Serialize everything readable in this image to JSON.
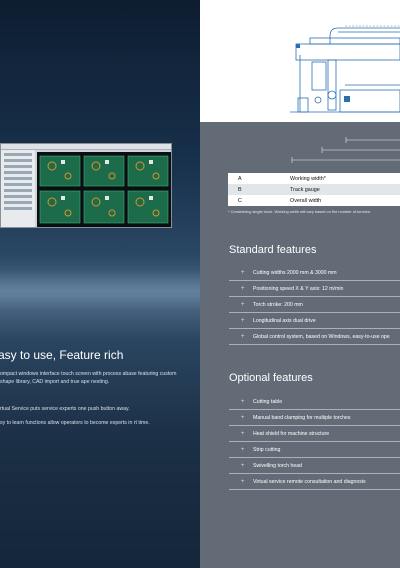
{
  "left": {
    "heading": "asy to use, Feature rich",
    "paragraphs": [
      "ompact windows interface touch screen with process abase featuring custom shape library, CAD import and true ape nesting.",
      "rtual Service puts service experts one push button away.",
      "sy to learn functions allow operators to become experts in rt time."
    ]
  },
  "spec_table": {
    "rows": [
      {
        "key": "A",
        "value": "Working width*"
      },
      {
        "key": "B",
        "value": "Track gauge"
      },
      {
        "key": "C",
        "value": "Overall width"
      }
    ],
    "note": "* Considering single torch. Working width will vary based on the number of torches."
  },
  "standard": {
    "title": "Standard features",
    "items": [
      "Cutting widths 2000 mm & 3000 mm",
      "Positioning speed X & Y axis: 12 m/min",
      "Torch stroke: 200 mm",
      "Longitudinal axis dual drive",
      "Global control system, based on Windows, easy-to-use ope"
    ]
  },
  "optional": {
    "title": "Optional features",
    "items": [
      "Cutting table",
      "Manual band clamping for multiple torches",
      "Heat shield for machine structure",
      "Strip cutting",
      "Swivelling torch head",
      "Virtual service remote consultation and diagnosis"
    ]
  },
  "plus_glyph": "+",
  "colors": {
    "left_bg": "#17304b",
    "right_panel": "#636c76",
    "drawing_blue": "#2a6fb0"
  }
}
